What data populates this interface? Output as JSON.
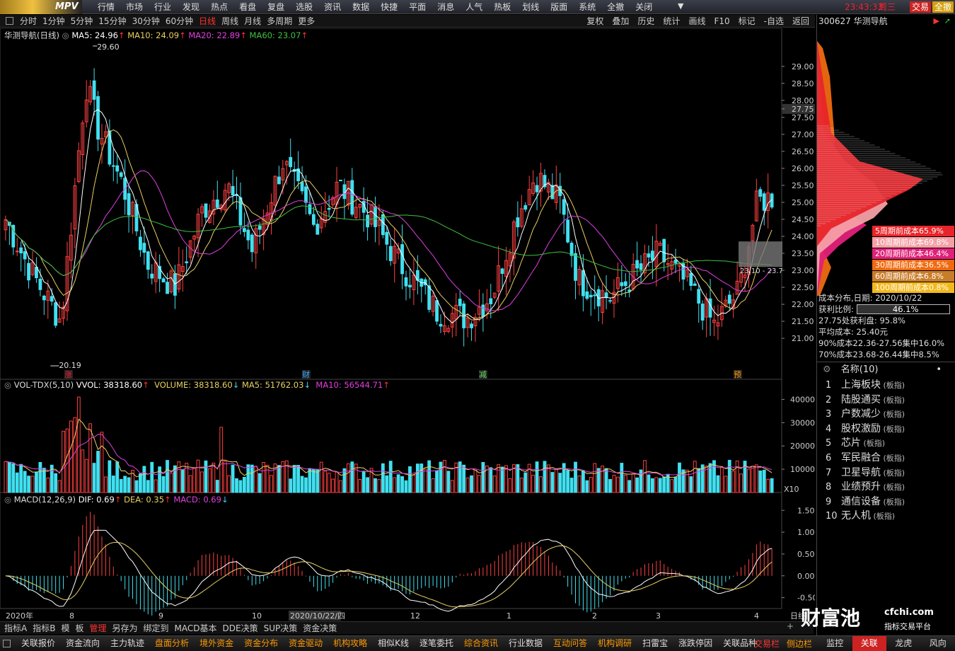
{
  "menubar": {
    "logo": "MPV",
    "items": [
      "行情",
      "市场",
      "行业",
      "发现",
      "热点",
      "看盘",
      "复盘",
      "选股",
      "资讯",
      "数据",
      "快捷",
      "平面",
      "消息",
      "人气",
      "热板",
      "划线",
      "版面",
      "系统",
      "全撤",
      "关闭"
    ],
    "clock": "23:43:33",
    "weekday": "周三",
    "trade_btn": "交易",
    "cancel_all_btn": "全撤"
  },
  "periods": {
    "items": [
      "分时",
      "1分钟",
      "5分钟",
      "15分钟",
      "30分钟",
      "60分钟",
      "日线",
      "周线",
      "月线",
      "多周期",
      "更多"
    ],
    "active": "日线"
  },
  "right_tools": [
    "复权",
    "叠加",
    "历史",
    "统计",
    "画线",
    "F10",
    "标记",
    "-自选",
    "返回"
  ],
  "stock": {
    "code": "300627",
    "name": "华测导航",
    "title": "华测导航(日线)"
  },
  "ma": {
    "ma5": "MA5: 24.96",
    "ma10": "MA10: 24.09",
    "ma20": "MA20: 22.89",
    "ma60": "MA60: 23.07"
  },
  "price_axis": [
    "29.00",
    "28.50",
    "28.00",
    "27.75",
    "27.50",
    "27.00",
    "26.50",
    "26.00",
    "25.50",
    "25.00",
    "24.50",
    "24.00",
    "23.50",
    "23.00",
    "22.50",
    "22.00",
    "21.50",
    "21.00"
  ],
  "annotations": {
    "high": "29.60",
    "low": "20.19",
    "range": "23.10 - 23.7",
    "events": [
      "涨",
      "财",
      "减",
      "预"
    ]
  },
  "volume": {
    "title": "VOL-TDX(5,10)",
    "vvol": "VVOL: 38318.60",
    "volume": "VOLUME: 38318.60",
    "ma5": "MA5: 51762.03",
    "ma10": "MA10: 56544.71",
    "axis": [
      "40000",
      "30000",
      "20000",
      "10000"
    ],
    "unit": "X10"
  },
  "macd": {
    "title": "MACD(12,26,9)",
    "dif": "DIF: 0.69",
    "dea": "DEA: 0.35",
    "macd": "MACD: 0.69",
    "axis": [
      "1.50",
      "1.00",
      "0.50",
      "0.00",
      "-0.50"
    ]
  },
  "date_axis": [
    "2020年",
    "8",
    "9",
    "10",
    "2020/10/22/四",
    "12",
    "1",
    "2",
    "3",
    "4"
  ],
  "date_axis_right": "日线",
  "cost": {
    "legend": [
      {
        "label": "5周期前成本65.9%",
        "color": "#e8252a"
      },
      {
        "label": "10周期前成本69.8%",
        "color": "#f5a0a6"
      },
      {
        "label": "20周期前成本46.4%",
        "color": "#e0207a"
      },
      {
        "label": "30周期前成本36.5%",
        "color": "#f06a10"
      },
      {
        "label": "60周期前成本6.8%",
        "color": "#c87d2a"
      },
      {
        "label": "100周期前成本0.8%",
        "color": "#f3b81c"
      }
    ],
    "date_label": "成本分布,日期:",
    "date": "2020/10/22",
    "profit_label": "获利比例:",
    "profit": "46.1%",
    "profit_fraction": 0.461,
    "price_profit": "27.75处获利盘: 95.8%",
    "avg_cost": "平均成本: 25.40元",
    "c90": "90%成本22.36-27.56集中16.0%",
    "c70": "70%成本23.68-26.44集中8.5%"
  },
  "sector_list": {
    "header": "名称(10)",
    "items": [
      {
        "n": "1",
        "name": "上海板块",
        "tag": "(板指)"
      },
      {
        "n": "2",
        "name": "陆股通买",
        "tag": "(板指)"
      },
      {
        "n": "3",
        "name": "户数减少",
        "tag": "(板指)"
      },
      {
        "n": "4",
        "name": "股权激励",
        "tag": "(板指)"
      },
      {
        "n": "5",
        "name": "芯片",
        "tag": "(板指)"
      },
      {
        "n": "6",
        "name": "军民融合",
        "tag": "(板指)"
      },
      {
        "n": "7",
        "name": "卫星导航",
        "tag": "(板指)"
      },
      {
        "n": "8",
        "name": "业绩预升",
        "tag": "(板指)"
      },
      {
        "n": "9",
        "name": "通信设备",
        "tag": "(板指)"
      },
      {
        "n": "10",
        "name": "无人机",
        "tag": "(板指)"
      }
    ]
  },
  "bottom1": {
    "items": [
      "指标A",
      "指标B",
      "模",
      "板",
      "管理",
      "另存为",
      "绑定到",
      "MACD基本",
      "DDE决策",
      "SUP决策",
      "资金决策"
    ],
    "active": "管理"
  },
  "bottom2": {
    "items": [
      "关联报价",
      "资金流向",
      "主力轨迹",
      "盘面分析",
      "境外资金",
      "资金分布",
      "资金驱动",
      "机构攻略",
      "相似K线",
      "逐笔委托",
      "综合资讯",
      "行业数据",
      "互动问答",
      "机构调研",
      "扫雷宝",
      "涨跌停因",
      "关联品种"
    ],
    "highlight": [
      "盘面分析",
      "境外资金",
      "资金分布",
      "资金驱动",
      "机构攻略",
      "综合资讯",
      "互动问答",
      "机构调研"
    ],
    "right": [
      "交易栏",
      "侧边栏"
    ],
    "tabs": [
      "监控",
      "关联",
      "龙虎",
      "风向"
    ]
  },
  "watermark": {
    "brand": "财富池",
    "site": "cfchi.com",
    "slogan": "指标交易平台"
  },
  "colors": {
    "up": "#ff4040",
    "down": "#40e0f0",
    "ma5": "#ffffff",
    "ma10": "#e8d060",
    "ma20": "#e040e0",
    "ma60": "#40c040"
  }
}
